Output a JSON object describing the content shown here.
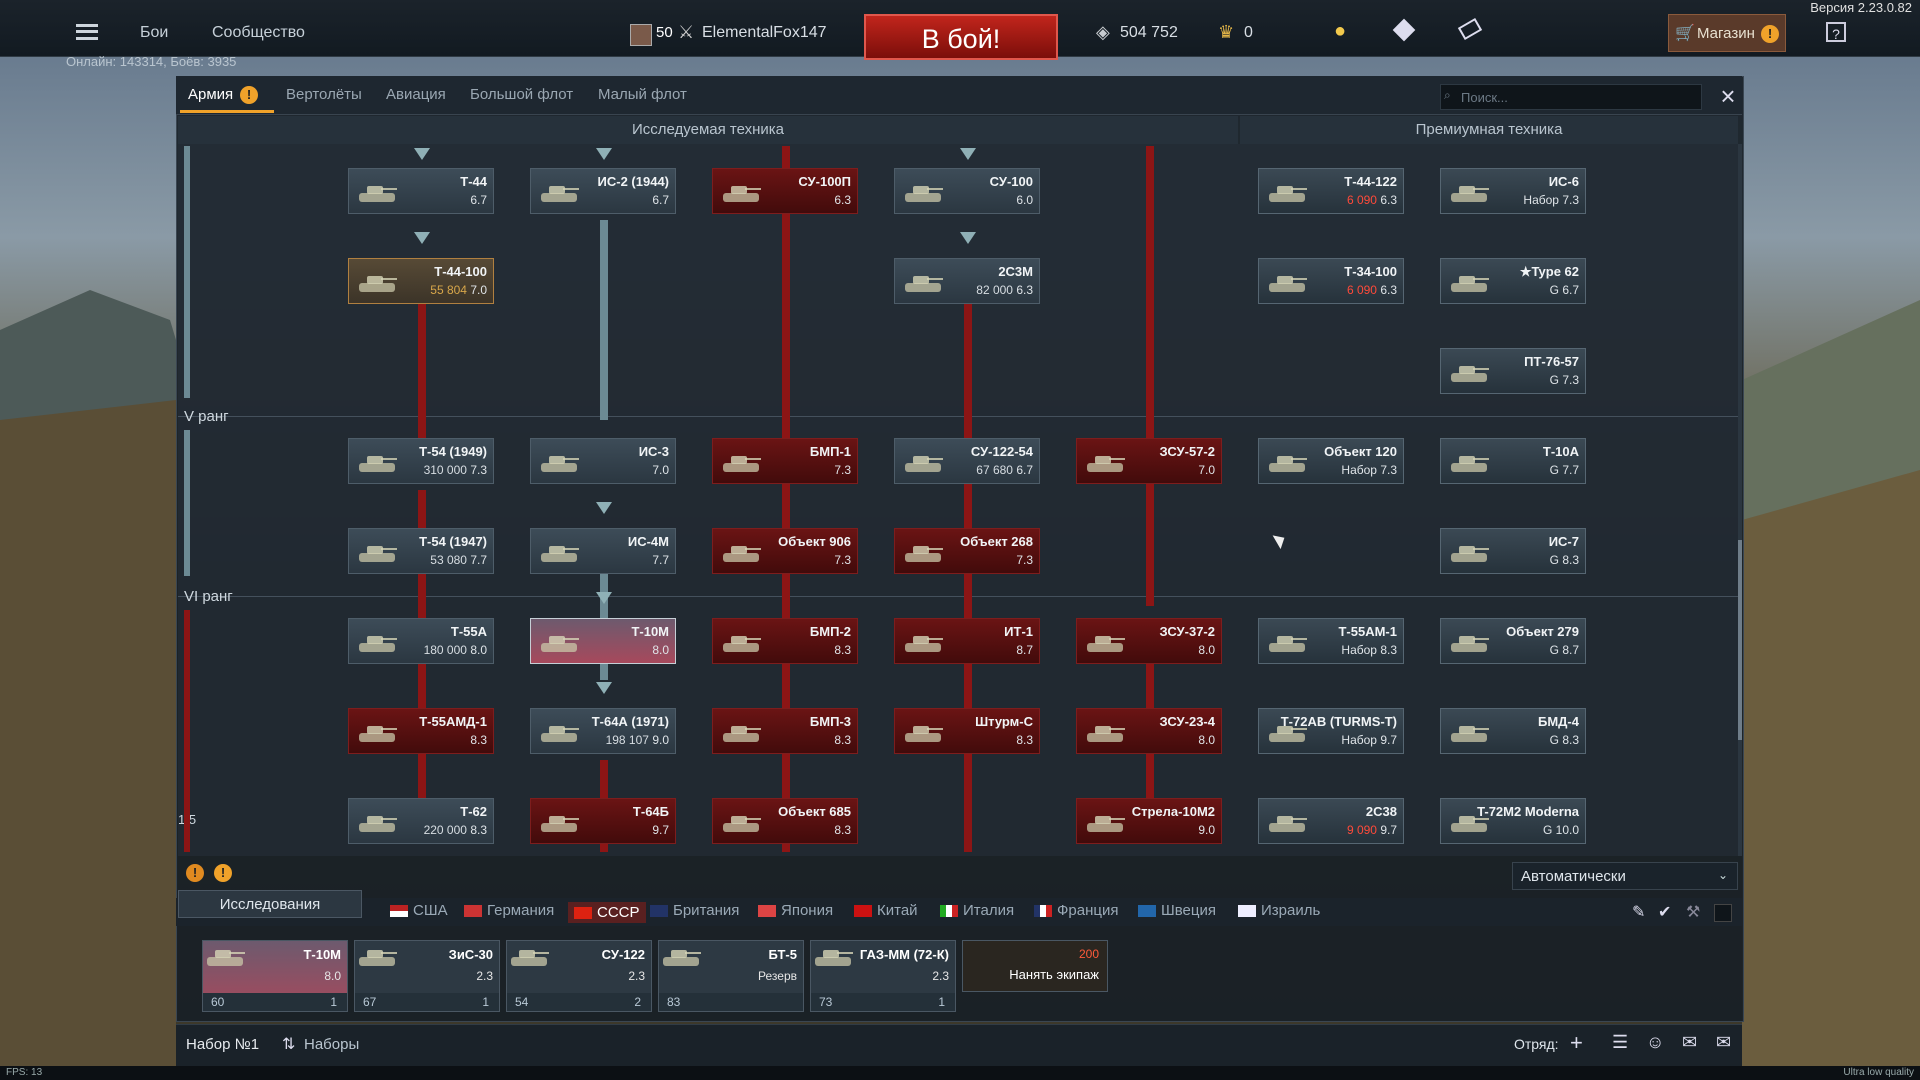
{
  "version": "Версия 2.23.0.82",
  "topbar": {
    "menu_items": [
      "Бои",
      "Сообщество"
    ],
    "online": "Онлайн: 143314, Боёв: 3935",
    "player_level": "50",
    "player_name": "ElementalFox147",
    "battle_button": "В бой!",
    "silver": "504 752",
    "gold": "0",
    "shop_label": "Магазин"
  },
  "window": {
    "tabs": [
      "Армия",
      "Вертолёты",
      "Авиация",
      "Большой флот",
      "Малый флот"
    ],
    "search_placeholder": "Поиск...",
    "section_research": "Исследуемая техника",
    "section_premium": "Премиумная техника",
    "rank_labels": [
      "V ранг",
      "VI ранг"
    ],
    "page_indicator": "1/5"
  },
  "tree": {
    "row1": [
      {
        "name": "Т-44",
        "br": "6.7",
        "state": "unlocked",
        "cost": ""
      },
      {
        "name": "ИС-2 (1944)",
        "br": "6.7",
        "state": "unlocked",
        "cost": ""
      },
      {
        "name": "СУ-100П",
        "br": "6.3",
        "state": "locked",
        "cost": ""
      },
      {
        "name": "СУ-100",
        "br": "6.0",
        "state": "unlocked",
        "cost": ""
      }
    ],
    "row2": [
      {
        "name": "Т-44-100",
        "br": "7.0",
        "state": "research",
        "cost": "55 804"
      },
      {
        "name": "2С3М",
        "br": "6.3",
        "state": "unlocked",
        "cost": "82 000"
      }
    ],
    "row3": [
      {
        "name": "Т-54 (1949)",
        "br": "7.3",
        "state": "unlocked",
        "cost": "310 000"
      },
      {
        "name": "ИС-3",
        "br": "7.0",
        "state": "unlocked",
        "cost": ""
      },
      {
        "name": "БМП-1",
        "br": "7.3",
        "state": "locked",
        "cost": ""
      },
      {
        "name": "СУ-122-54",
        "br": "6.7",
        "state": "unlocked",
        "cost": "67 680"
      },
      {
        "name": "ЗСУ-57-2",
        "br": "7.0",
        "state": "locked",
        "cost": ""
      }
    ],
    "row4": [
      {
        "name": "Т-54 (1947)",
        "br": "7.7",
        "state": "unlocked",
        "cost": "53 080"
      },
      {
        "name": "ИС-4М",
        "br": "7.7",
        "state": "unlocked",
        "cost": ""
      },
      {
        "name": "Объект 906",
        "br": "7.3",
        "state": "locked",
        "cost": ""
      },
      {
        "name": "Объект 268",
        "br": "7.3",
        "state": "locked",
        "cost": ""
      }
    ],
    "row5": [
      {
        "name": "Т-55А",
        "br": "8.0",
        "state": "unlocked",
        "cost": "180 000"
      },
      {
        "name": "Т-10М",
        "br": "8.0",
        "state": "selected",
        "cost": ""
      },
      {
        "name": "БМП-2",
        "br": "8.3",
        "state": "locked",
        "cost": ""
      },
      {
        "name": "ИТ-1",
        "br": "8.7",
        "state": "locked",
        "cost": ""
      },
      {
        "name": "ЗСУ-37-2",
        "br": "8.0",
        "state": "locked",
        "cost": ""
      }
    ],
    "row6": [
      {
        "name": "Т-55АМД-1",
        "br": "8.3",
        "state": "locked",
        "cost": ""
      },
      {
        "name": "Т-64А (1971)",
        "br": "9.0",
        "state": "unlocked",
        "cost": "198 107"
      },
      {
        "name": "БМП-3",
        "br": "8.3",
        "state": "locked",
        "cost": ""
      },
      {
        "name": "Штурм-С",
        "br": "8.3",
        "state": "locked",
        "cost": ""
      },
      {
        "name": "ЗСУ-23-4",
        "br": "8.0",
        "state": "locked",
        "cost": ""
      }
    ],
    "row7": [
      {
        "name": "Т-62",
        "br": "8.3",
        "state": "unlocked",
        "cost": "220 000"
      },
      {
        "name": "Т-64Б",
        "br": "9.7",
        "state": "locked",
        "cost": ""
      },
      {
        "name": "Объект 685",
        "br": "8.3",
        "state": "locked",
        "cost": ""
      },
      {
        "name": "Стрела-10М2",
        "br": "9.0",
        "state": "locked",
        "cost": ""
      }
    ]
  },
  "premium": [
    {
      "name": "Т-44-122",
      "br": "6.3",
      "cost": "6 090"
    },
    {
      "name": "ИС-6",
      "br": "7.3",
      "cost": "Набор"
    },
    {
      "name": "Т-34-100",
      "br": "6.3",
      "cost": "6 090"
    },
    {
      "name": "★Type 62",
      "br": "6.7",
      "cost": "G"
    },
    {
      "name": "ПТ-76-57",
      "br": "7.3",
      "cost": "G"
    },
    {
      "name": "Объект 120",
      "br": "7.3",
      "cost": "Набор"
    },
    {
      "name": "Т-10А",
      "br": "7.7",
      "cost": "G"
    },
    {
      "name": "ИС-7",
      "br": "8.3",
      "cost": "G"
    },
    {
      "name": "Т-55АМ-1",
      "br": "8.3",
      "cost": "Набор"
    },
    {
      "name": "Объект 279",
      "br": "8.7",
      "cost": "G"
    },
    {
      "name": "Т-72АВ (TURMS-T)",
      "br": "9.7",
      "cost": "Набор"
    },
    {
      "name": "БМД-4",
      "br": "8.3",
      "cost": "G"
    },
    {
      "name": "2С38",
      "br": "9.7",
      "cost": "9 090"
    },
    {
      "name": "T-72M2 Moderna",
      "br": "10.0",
      "cost": "G"
    }
  ],
  "bottom": {
    "research_label": "Исследования",
    "dropdown_value": "Автоматически",
    "nations": [
      "США",
      "Германия",
      "СССР",
      "Британия",
      "Япония",
      "Китай",
      "Италия",
      "Франция",
      "Швеция",
      "Израиль"
    ],
    "crew_slots": [
      {
        "name": "Т-10М",
        "br": "8.0",
        "crew": "60",
        "num": "1"
      },
      {
        "name": "ЗиС-30",
        "br": "2.3",
        "crew": "67",
        "num": "1"
      },
      {
        "name": "СУ-122",
        "br": "2.3",
        "crew": "54",
        "num": "2"
      },
      {
        "name": "БТ-5",
        "br": "Резерв",
        "crew": "83",
        "num": ""
      },
      {
        "name": "ГАЗ-ММ (72-К)",
        "br": "2.3",
        "crew": "73",
        "num": "1"
      }
    ],
    "hire_crew": "Нанять экипаж",
    "hire_cost": "200",
    "preset": "Набор №1",
    "presets": "Наборы",
    "squad": "Отряд:"
  },
  "status": {
    "fps": "FPS: 13",
    "quality": "Ultra low quality"
  },
  "colors": {
    "locked": "#6a1414",
    "battle": "#c1251c",
    "accent": "#f0a22a"
  }
}
